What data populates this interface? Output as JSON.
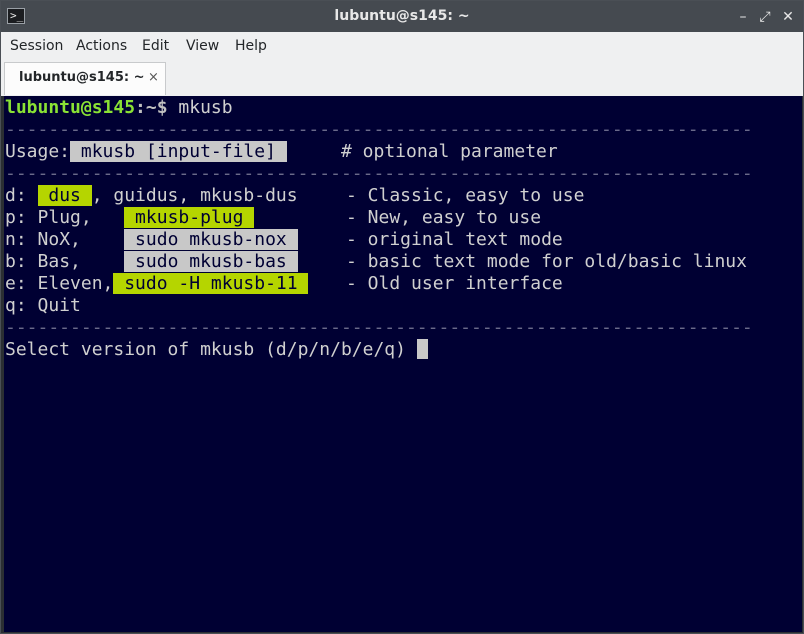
{
  "window": {
    "title": "lubuntu@s145: ~",
    "app_icon_glyph": ">_",
    "min_glyph": "–",
    "max_glyph": "⤢",
    "close_glyph": "✕"
  },
  "menubar": {
    "items": [
      "Session",
      "Actions",
      "Edit",
      "View",
      "Help"
    ]
  },
  "tabs": [
    {
      "label": "lubuntu@s145: ~",
      "close": "×"
    }
  ],
  "terminal": {
    "prompt_user": "lubuntu@s145",
    "prompt_path": ":~$",
    "command": " mkusb",
    "separator": "---------------------------------------------------------------------",
    "usage_label": "Usage:",
    "usage_cmd": " mkusb [input-file] ",
    "usage_comment": "     # optional parameter",
    "options": [
      {
        "key": "d: ",
        "name": "",
        "cmd": " dus ",
        "rest": ", guidus, mkusb-dus",
        "desc": "- Classic, easy to use",
        "hl": "green"
      },
      {
        "key": "p: ",
        "name": "Plug,  ",
        "cmd": " mkusb-plug ",
        "rest": "",
        "desc": "- New, easy to use",
        "hl": "green"
      },
      {
        "key": "n: ",
        "name": "NoX,   ",
        "cmd": " sudo mkusb-nox ",
        "rest": "",
        "desc": "- original text mode",
        "hl": "grey"
      },
      {
        "key": "b: ",
        "name": "Bas,   ",
        "cmd": " sudo mkusb-bas ",
        "rest": "",
        "desc": "- basic text mode for old/basic linux",
        "hl": "grey"
      },
      {
        "key": "e: ",
        "name": "Eleven,",
        "cmd": " sudo -H mkusb-11 ",
        "rest": "",
        "desc": "- Old user interface",
        "hl": "green"
      }
    ],
    "quit": "q: Quit",
    "select_prompt": "Select version of mkusb (d/p/n/b/e/q) "
  }
}
